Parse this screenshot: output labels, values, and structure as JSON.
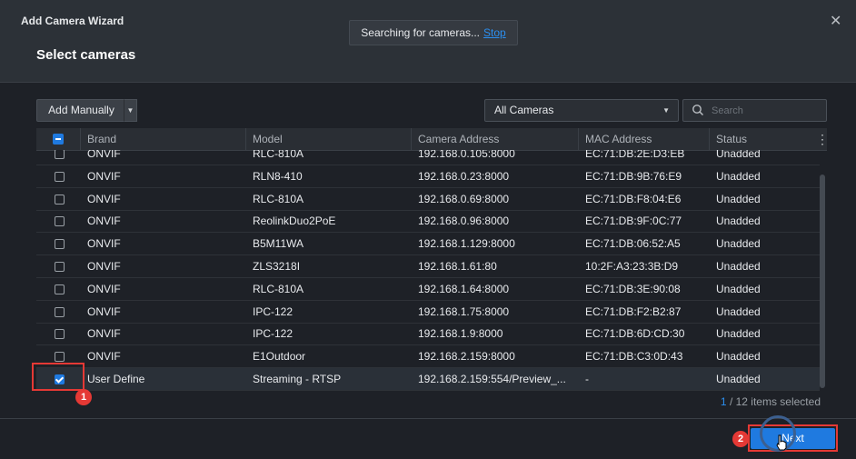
{
  "window": {
    "title": "Add Camera Wizard",
    "page_title": "Select cameras",
    "close_glyph": "✕"
  },
  "searching": {
    "text": "Searching for cameras...",
    "stop_label": "Stop"
  },
  "toolbar": {
    "add_manually_label": "Add Manually",
    "filter_selected": "All Cameras",
    "search_placeholder": "Search"
  },
  "table": {
    "columns": [
      "Brand",
      "Model",
      "Camera Address",
      "MAC Address",
      "Status"
    ],
    "rows": [
      {
        "checked": false,
        "brand": "ONVIF",
        "model": "RLC-810A",
        "address": "192.168.0.105:8000",
        "mac": "EC:71:DB:2E:D3:EB",
        "status": "Unadded"
      },
      {
        "checked": false,
        "brand": "ONVIF",
        "model": "RLN8-410",
        "address": "192.168.0.23:8000",
        "mac": "EC:71:DB:9B:76:E9",
        "status": "Unadded"
      },
      {
        "checked": false,
        "brand": "ONVIF",
        "model": "RLC-810A",
        "address": "192.168.0.69:8000",
        "mac": "EC:71:DB:F8:04:E6",
        "status": "Unadded"
      },
      {
        "checked": false,
        "brand": "ONVIF",
        "model": "ReolinkDuo2PoE",
        "address": "192.168.0.96:8000",
        "mac": "EC:71:DB:9F:0C:77",
        "status": "Unadded"
      },
      {
        "checked": false,
        "brand": "ONVIF",
        "model": "B5M11WA",
        "address": "192.168.1.129:8000",
        "mac": "EC:71:DB:06:52:A5",
        "status": "Unadded"
      },
      {
        "checked": false,
        "brand": "ONVIF",
        "model": "ZLS3218I",
        "address": "192.168.1.61:80",
        "mac": "10:2F:A3:23:3B:D9",
        "status": "Unadded"
      },
      {
        "checked": false,
        "brand": "ONVIF",
        "model": "RLC-810A",
        "address": "192.168.1.64:8000",
        "mac": "EC:71:DB:3E:90:08",
        "status": "Unadded"
      },
      {
        "checked": false,
        "brand": "ONVIF",
        "model": "IPC-122",
        "address": "192.168.1.75:8000",
        "mac": "EC:71:DB:F2:B2:87",
        "status": "Unadded"
      },
      {
        "checked": false,
        "brand": "ONVIF",
        "model": "IPC-122",
        "address": "192.168.1.9:8000",
        "mac": "EC:71:DB:6D:CD:30",
        "status": "Unadded"
      },
      {
        "checked": false,
        "brand": "ONVIF",
        "model": "E1Outdoor",
        "address": "192.168.2.159:8000",
        "mac": "EC:71:DB:C3:0D:43",
        "status": "Unadded"
      },
      {
        "checked": true,
        "brand": "User Define",
        "model": "Streaming - RTSP",
        "address": "192.168.2.159:554/Preview_...",
        "mac": "-",
        "status": "Unadded"
      }
    ]
  },
  "selection": {
    "count": "1",
    "suffix": " / 12 items selected"
  },
  "footer": {
    "next_label": "Next"
  },
  "annotations": {
    "step1": "1",
    "step2": "2"
  },
  "colors": {
    "accent": "#1f7ae0",
    "highlight": "#e53935"
  }
}
